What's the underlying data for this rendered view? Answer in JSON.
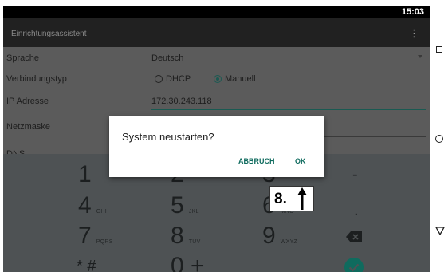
{
  "status": {
    "time": "15:03"
  },
  "appbar": {
    "title": "Einrichtungsassistent",
    "menu_icon": "⋮"
  },
  "form": {
    "sprache_label": "Sprache",
    "sprache_value": "Deutsch",
    "verbindung_label": "Verbindungstyp",
    "dhcp_label": "DHCP",
    "manuell_label": "Manuell",
    "ip_label": "IP Adresse",
    "ip_value": "172.30.243.118",
    "netz_label": "Netzmaske",
    "dns_label": "DNS"
  },
  "keypad": {
    "k1": "1",
    "k2": "2",
    "k3": "3",
    "k4": "4",
    "k4s": "GHI",
    "k5": "5",
    "k5s": "JKL",
    "k6": "6",
    "k6s": "MNO",
    "k7": "7",
    "k7s": "PQRS",
    "k8": "8",
    "k8s": "TUV",
    "k9": "9",
    "k9s": "WXYZ",
    "kstar": "* #",
    "k0": "0 +",
    "dash": "-",
    "dot": "."
  },
  "dialog": {
    "message": "System neustarten?",
    "cancel": "ABBRUCH",
    "ok": "OK"
  },
  "callout": {
    "step": "8."
  },
  "colors": {
    "accent": "#0f6b5e",
    "keypad_bg": "#4e5254"
  }
}
